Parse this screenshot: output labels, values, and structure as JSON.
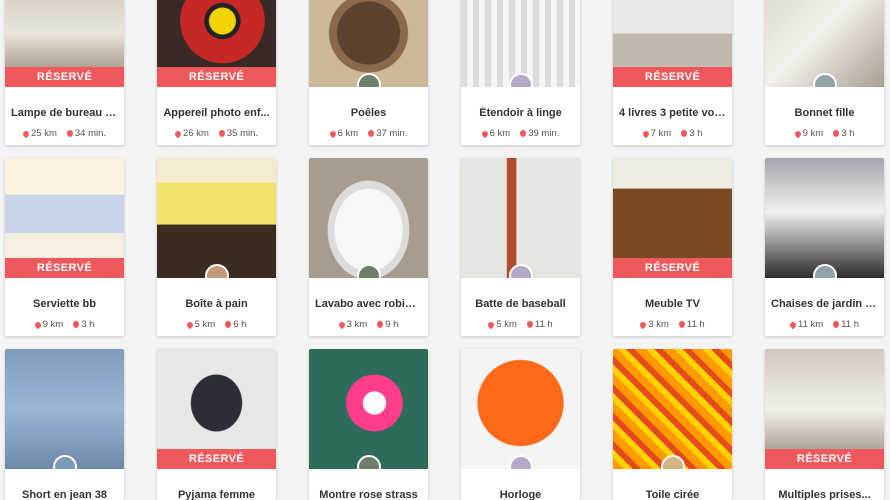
{
  "reserved_label": "RÉSERVÉ",
  "accent_color": "#f0595b",
  "rows": [
    [
      {
        "title": "Lampe de bureau o...",
        "distance": "25 km",
        "time": "34 min.",
        "reserved": true,
        "photo": "desk-lamp"
      },
      {
        "title": "Appereil photo enf...",
        "distance": "26 km",
        "time": "35 min.",
        "reserved": true,
        "photo": "kids-camera"
      },
      {
        "title": "Poêles",
        "distance": "6 km",
        "time": "37 min.",
        "reserved": false,
        "photo": "pans"
      },
      {
        "title": "Étendoir à linge",
        "distance": "6 km",
        "time": "39 min.",
        "reserved": false,
        "photo": "drying-rack"
      },
      {
        "title": "4 livres 3 petite voi...",
        "distance": "7 km",
        "time": "3 h",
        "reserved": true,
        "photo": "toy-cars"
      },
      {
        "title": "Bonnet fille",
        "distance": "9 km",
        "time": "3 h",
        "reserved": false,
        "photo": "hat"
      }
    ],
    [
      {
        "title": "Serviette bb",
        "distance": "9 km",
        "time": "3 h",
        "reserved": true,
        "photo": "towels"
      },
      {
        "title": "Boîte à pain",
        "distance": "5 km",
        "time": "6 h",
        "reserved": false,
        "photo": "bread-box"
      },
      {
        "title": "Lavabo avec robinet.",
        "distance": "3 km",
        "time": "9 h",
        "reserved": false,
        "photo": "sink"
      },
      {
        "title": "Batte de baseball",
        "distance": "5 km",
        "time": "11 h",
        "reserved": false,
        "photo": "bat"
      },
      {
        "title": "Meuble TV",
        "distance": "3 km",
        "time": "11 h",
        "reserved": true,
        "photo": "tv-stand"
      },
      {
        "title": "Chaises de jardin e...",
        "distance": "11 km",
        "time": "11 h",
        "reserved": false,
        "photo": "garden-chairs"
      }
    ],
    [
      {
        "title": "Short en jean 38",
        "distance": "",
        "time": "",
        "reserved": false,
        "photo": "jean-shorts"
      },
      {
        "title": "Pyjama femme",
        "distance": "",
        "time": "",
        "reserved": true,
        "photo": "pyjama"
      },
      {
        "title": "Montre rose strass",
        "distance": "",
        "time": "",
        "reserved": false,
        "photo": "pink-watch"
      },
      {
        "title": "Horloge",
        "distance": "",
        "time": "",
        "reserved": false,
        "photo": "clock"
      },
      {
        "title": "Toile cirée",
        "distance": "",
        "time": "",
        "reserved": false,
        "photo": "oilcloth"
      },
      {
        "title": "Multiples prises...",
        "distance": "",
        "time": "",
        "reserved": true,
        "photo": "power-strips"
      }
    ]
  ]
}
